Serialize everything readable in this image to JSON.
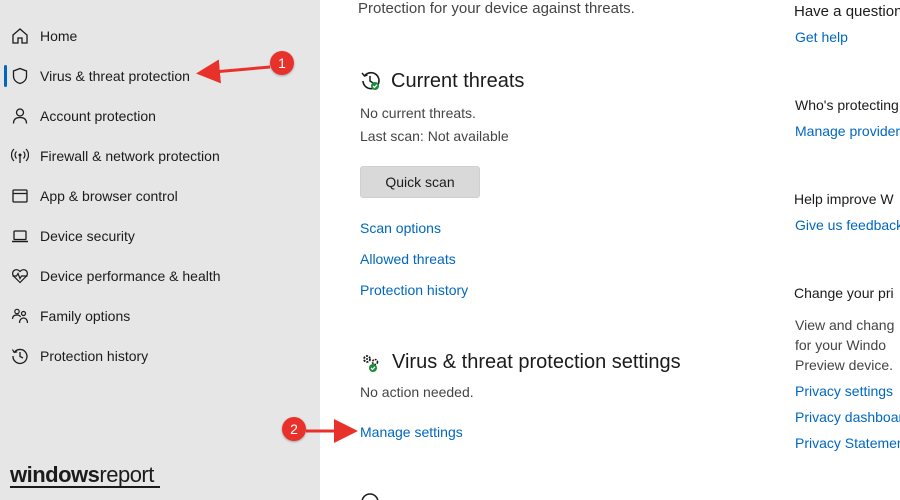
{
  "sidebar": {
    "items": [
      {
        "label": "Home",
        "icon": "home-icon"
      },
      {
        "label": "Virus & threat protection",
        "icon": "shield-icon",
        "active": true
      },
      {
        "label": "Account protection",
        "icon": "person-icon"
      },
      {
        "label": "Firewall & network protection",
        "icon": "wifi-antenna-icon"
      },
      {
        "label": "App & browser control",
        "icon": "browser-window-icon"
      },
      {
        "label": "Device security",
        "icon": "laptop-icon"
      },
      {
        "label": "Device performance & health",
        "icon": "heart-pulse-icon"
      },
      {
        "label": "Family options",
        "icon": "family-icon"
      },
      {
        "label": "Protection history",
        "icon": "history-icon"
      }
    ]
  },
  "main": {
    "intro": "Protection for your device against threats.",
    "current_threats": {
      "title": "Current threats",
      "status": "No current threats.",
      "last_scan": "Last scan: Not available",
      "quick_scan_label": "Quick scan",
      "links": [
        "Scan options",
        "Allowed threats",
        "Protection history"
      ]
    },
    "settings": {
      "title": "Virus & threat protection settings",
      "status": "No action needed.",
      "link": "Manage settings"
    }
  },
  "right_panel": {
    "question_title": "Have a question",
    "get_help": "Get help",
    "protecting_title": "Who's protecting",
    "manage_providers": "Manage provider",
    "improve_title": "Help improve W",
    "feedback": "Give us feedback",
    "privacy_title": "Change your pri",
    "privacy_text": [
      "View and chang",
      "for your Windo",
      "Preview device."
    ],
    "privacy_links": [
      "Privacy settings",
      "Privacy dashboar",
      "Privacy Statemen"
    ]
  },
  "annotations": {
    "callout_1": "1",
    "callout_2": "2"
  },
  "watermark": {
    "part1": "windows",
    "part2": "report"
  },
  "colors": {
    "accent": "#0067c0",
    "sidebar_bg": "#e6e6e6",
    "callout": "#e8312b"
  }
}
